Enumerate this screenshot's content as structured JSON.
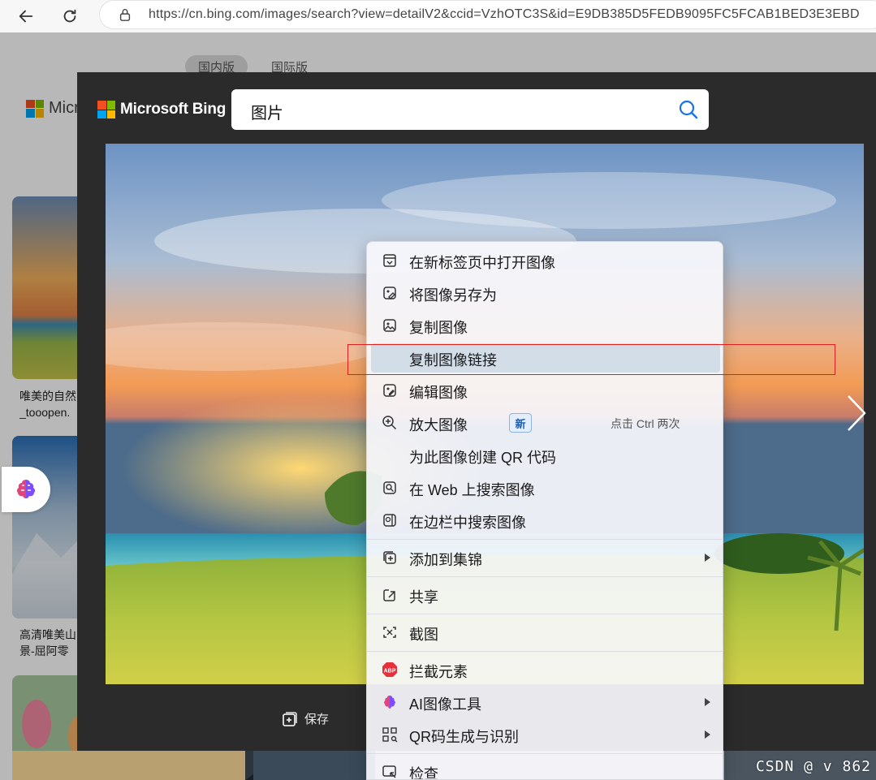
{
  "browser": {
    "url": "https://cn.bing.com/images/search?view=detailV2&ccid=VzhOTC3S&id=E9DB385D5FEDB9095FC5FCAB1BED3E3EBD"
  },
  "background_page": {
    "tabs": [
      "国内版",
      "国际版"
    ],
    "logo_partial": "Micr",
    "captions": [
      {
        "line1": "唯美的自然",
        "line2": "_tooopen."
      },
      {
        "line1": "高清唯美山",
        "line2": "景-屈阿零"
      }
    ]
  },
  "viewer": {
    "logo_text": "Microsoft Bing",
    "search_value": "图片",
    "save_label": "保存",
    "watermark": "CSDN @    v 862"
  },
  "context_menu": {
    "items": [
      {
        "label": "在新标签页中打开图像",
        "icon": "open-new-tab-icon"
      },
      {
        "label": "将图像另存为",
        "icon": "save-image-icon"
      },
      {
        "label": "复制图像",
        "icon": "copy-image-icon"
      },
      {
        "label": "复制图像链接",
        "icon": "",
        "highlighted": true
      },
      {
        "label": "编辑图像",
        "icon": "edit-image-icon"
      },
      {
        "label": "放大图像",
        "icon": "zoom-in-icon",
        "badge": "新",
        "hint": "点击 Ctrl 两次"
      },
      {
        "label": "为此图像创建 QR 代码",
        "icon": ""
      },
      {
        "label": "在 Web 上搜索图像",
        "icon": "web-search-image-icon"
      },
      {
        "label": "在边栏中搜索图像",
        "icon": "sidebar-search-icon"
      },
      {
        "label": "添加到集锦",
        "icon": "collections-icon",
        "submenu": true
      },
      {
        "label": "共享",
        "icon": "share-icon"
      },
      {
        "label": "截图",
        "icon": "screenshot-icon"
      },
      {
        "label": "拦截元素",
        "icon": "abp-icon"
      },
      {
        "label": "AI图像工具",
        "icon": "ai-brain-icon",
        "submenu": true
      },
      {
        "label": "QR码生成与识别",
        "icon": "qr-code-icon",
        "submenu": true
      },
      {
        "label": "检查",
        "icon": "inspect-icon"
      }
    ],
    "abp_text": "ABP"
  },
  "colors": {
    "viewer_bg": "#2b2b2b",
    "menu_highlight": "#d2dde8",
    "annotation_red": "#e02020",
    "bing_blue": "#1a73e8"
  }
}
